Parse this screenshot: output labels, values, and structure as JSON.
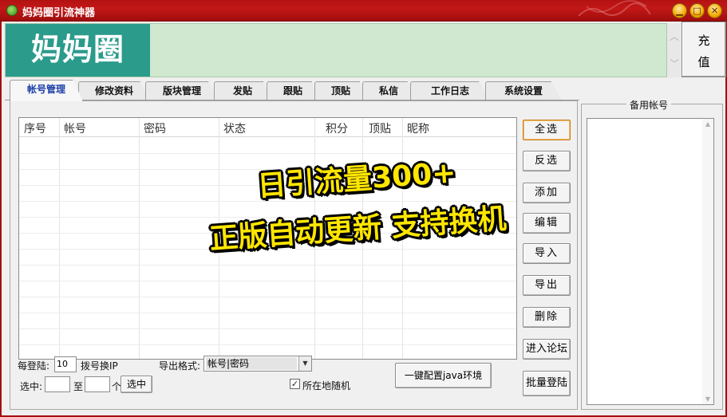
{
  "window": {
    "title": "妈妈圈引流神器",
    "min_label": "▁",
    "max_label": "□",
    "close_label": "✕"
  },
  "banner": {
    "logo_text": "妈妈圈",
    "scroll_up": "︿",
    "scroll_down": "﹀",
    "recharge_line1": "充",
    "recharge_line2": "值"
  },
  "tabs": [
    "帐号管理",
    "修改资料",
    "版块管理",
    "发贴",
    "跟贴",
    "顶贴",
    "私信",
    "工作日志",
    "系统设置"
  ],
  "grid": {
    "columns": [
      "序号",
      "帐号",
      "密码",
      "状态",
      "积分",
      "顶贴",
      "昵称"
    ]
  },
  "side_buttons": {
    "select_all": "全选",
    "invert": "反选",
    "add": "添加",
    "edit": "编辑",
    "import": "导入",
    "export": "导出",
    "delete": "删除",
    "enter_forum": "进入论坛",
    "batch_login": "批量登陆"
  },
  "bottom": {
    "per_login_label": "每登陆:",
    "per_login_value": "10",
    "dial_label": "拨号换IP",
    "export_format_label": "导出格式:",
    "export_format_value": "帐号|密码",
    "select_label": "选中:",
    "to_label": "至",
    "unit_label": "个",
    "select_button": "选中",
    "java_button": "一键配置java环境",
    "random_label": "所在地随机",
    "random_checked": true
  },
  "backup": {
    "title": "备用帐号",
    "scroll_up": "▲",
    "scroll_down": "▼"
  },
  "promo": {
    "line1": "日引流量300+",
    "line2": "正版自动更新 支持换机"
  }
}
